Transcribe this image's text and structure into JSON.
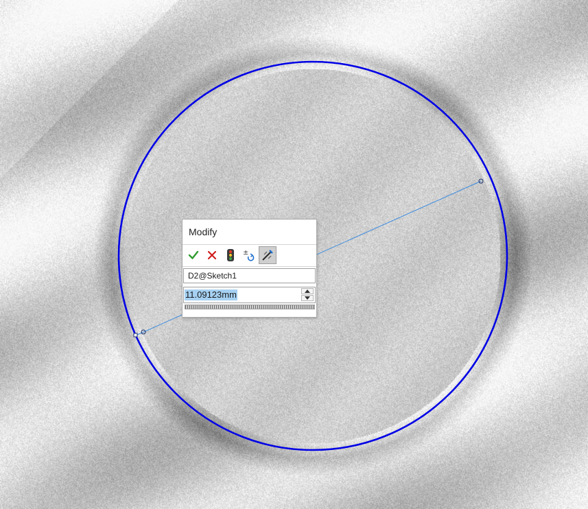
{
  "dialog": {
    "title": "Modify",
    "dimension_name": "D2@Sketch1",
    "value": "11.09123mm"
  },
  "toolbar": {
    "buttons": [
      {
        "name": "ok-check-icon",
        "color": "#2e9b2e"
      },
      {
        "name": "cancel-x-icon",
        "color": "#d11d1d"
      },
      {
        "name": "rebuild-traffic-light-icon",
        "color": "#3fa34d"
      },
      {
        "name": "reverse-sense-icon",
        "color": "#1f6fd0"
      },
      {
        "name": "mark-for-drawing-icon",
        "color": "#1f6fd0"
      }
    ]
  },
  "colors": {
    "circle": "#0000e6",
    "dimension_line": "#3d8de0",
    "background": "#d7d7d7"
  }
}
